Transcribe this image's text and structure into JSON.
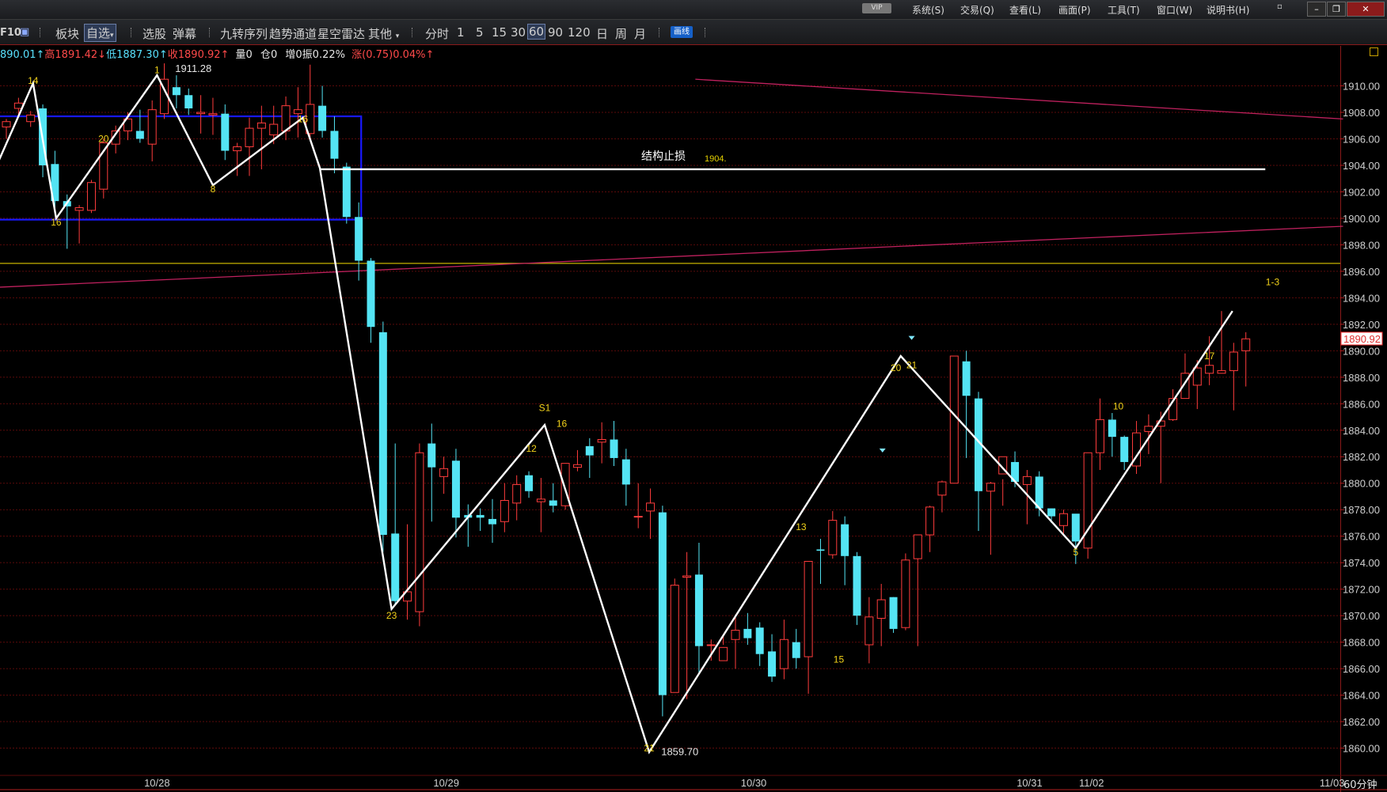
{
  "window": {
    "vip_badge": "VIP",
    "menus": [
      "系统(S)",
      "交易(Q)",
      "查看(L)",
      "画面(P)",
      "工具(T)",
      "窗口(W)",
      "说明书(H)"
    ],
    "buttons": [
      "▫",
      "–",
      "❐",
      "✕"
    ]
  },
  "toolbar": {
    "logo": "F10",
    "items": [
      "板块",
      "自选",
      "选股",
      "弹幕",
      "九转序列",
      "趋势通道",
      "星空雷达",
      "其他"
    ],
    "selected": "自选",
    "periods": [
      "分时",
      "1",
      "5",
      "15",
      "30",
      "60",
      "90",
      "120",
      "日",
      "周",
      "月"
    ],
    "selected_period": "60",
    "draw_button": "画线"
  },
  "infobar": {
    "open": "890.01↑",
    "high_label": "高",
    "high": "1891.42↓",
    "low_label": "低",
    "low": "1887.30↑",
    "close_label": "收",
    "close": "1890.92↑",
    "volume": "量0",
    "position": "仓0",
    "increase": "增0",
    "amplitude": "振0.22%",
    "change_label": "涨",
    "change": "(0.75)0.04%↑"
  },
  "period_label": "60分钟",
  "chart_data": {
    "type": "candlestick",
    "ylim": [
      1858.8,
      1912.6
    ],
    "y_ticks": [
      "1910.00",
      "1908.00",
      "1906.00",
      "1904.00",
      "1902.00",
      "1900.00",
      "1898.00",
      "1896.00",
      "1894.00",
      "1892.00",
      "1890.00",
      "1888.00",
      "1886.00",
      "1884.00",
      "1882.00",
      "1880.00",
      "1878.00",
      "1876.00",
      "1874.00",
      "1872.00",
      "1870.00",
      "1868.00",
      "1866.00",
      "1864.00",
      "1862.00",
      "1860.00"
    ],
    "current_price": "1890.92",
    "x_labels": [
      {
        "label": "10/28",
        "bar": 12.4
      },
      {
        "label": "10/29",
        "bar": 36.2
      },
      {
        "label": "10/30",
        "bar": 61.5
      },
      {
        "label": "10/31",
        "bar": 84.2
      },
      {
        "label": "11/02",
        "bar": 89.3
      },
      {
        "label": "11/03",
        "bar": 109.1
      }
    ],
    "candles": [
      [
        1906.9,
        1907.5,
        1906.0,
        1907.3
      ],
      [
        1908.3,
        1909.1,
        1907.8,
        1908.7
      ],
      [
        1907.3,
        1908.1,
        1906.9,
        1907.8
      ],
      [
        1908.3,
        1908.6,
        1903.1,
        1904.0
      ],
      [
        1904.1,
        1905.1,
        1900.5,
        1901.3
      ],
      [
        1901.3,
        1901.8,
        1897.7,
        1900.9
      ],
      [
        1900.6,
        1901.0,
        1898.1,
        1900.8
      ],
      [
        1900.6,
        1902.9,
        1900.4,
        1902.7
      ],
      [
        1902.2,
        1906.0,
        1901.5,
        1905.7
      ],
      [
        1905.6,
        1907.0,
        1904.9,
        1906.6
      ],
      [
        1906.6,
        1908.0,
        1905.9,
        1907.5
      ],
      [
        1906.6,
        1908.2,
        1905.7,
        1906.0
      ],
      [
        1905.6,
        1908.9,
        1904.3,
        1908.2
      ],
      [
        1907.9,
        1911.7,
        1907.5,
        1910.5
      ],
      [
        1909.9,
        1910.8,
        1908.3,
        1909.3
      ],
      [
        1909.3,
        1909.8,
        1907.8,
        1908.3
      ],
      [
        1907.9,
        1909.3,
        1906.4,
        1908.0
      ],
      [
        1907.8,
        1909.1,
        1906.3,
        1907.9
      ],
      [
        1907.9,
        1908.6,
        1904.4,
        1905.1
      ],
      [
        1905.1,
        1905.7,
        1903.2,
        1905.4
      ],
      [
        1905.4,
        1907.6,
        1903.2,
        1906.8
      ],
      [
        1906.8,
        1908.5,
        1903.7,
        1907.2
      ],
      [
        1906.3,
        1908.5,
        1905.6,
        1907.1
      ],
      [
        1906.6,
        1909.2,
        1905.9,
        1908.5
      ],
      [
        1907.9,
        1909.9,
        1906.1,
        1908.2
      ],
      [
        1906.4,
        1911.6,
        1905.9,
        1908.6
      ],
      [
        1908.5,
        1910.0,
        1906.1,
        1906.6
      ],
      [
        1906.6,
        1907.7,
        1903.4,
        1904.5
      ],
      [
        1903.9,
        1904.2,
        1899.6,
        1900.1
      ],
      [
        1900.1,
        1901.2,
        1895.3,
        1896.8
      ],
      [
        1896.8,
        1897.0,
        1890.6,
        1891.8
      ],
      [
        1891.4,
        1892.2,
        1874.8,
        1876.1
      ],
      [
        1876.2,
        1883.0,
        1870.9,
        1871.1
      ],
      [
        1871.1,
        1876.9,
        1869.7,
        1871.8
      ],
      [
        1870.3,
        1883.0,
        1869.2,
        1882.3
      ],
      [
        1883.0,
        1884.5,
        1877.1,
        1881.2
      ],
      [
        1880.5,
        1882.0,
        1879.2,
        1881.1
      ],
      [
        1881.7,
        1882.6,
        1875.9,
        1877.4
      ],
      [
        1877.6,
        1878.4,
        1875.2,
        1877.4
      ],
      [
        1877.6,
        1878.1,
        1876.4,
        1877.4
      ],
      [
        1877.3,
        1878.8,
        1875.5,
        1876.9
      ],
      [
        1877.1,
        1880.0,
        1876.3,
        1878.7
      ],
      [
        1878.5,
        1880.6,
        1877.2,
        1879.9
      ],
      [
        1880.6,
        1880.9,
        1878.9,
        1879.4
      ],
      [
        1878.6,
        1880.4,
        1876.3,
        1878.8
      ],
      [
        1878.7,
        1880.0,
        1877.8,
        1878.3
      ],
      [
        1878.3,
        1881.2,
        1878.0,
        1881.5
      ],
      [
        1881.2,
        1882.5,
        1880.9,
        1881.4
      ],
      [
        1882.8,
        1883.4,
        1880.4,
        1882.1
      ],
      [
        1883.1,
        1884.6,
        1881.5,
        1883.3
      ],
      [
        1883.3,
        1884.7,
        1881.3,
        1881.9
      ],
      [
        1881.8,
        1882.6,
        1878.3,
        1879.9
      ],
      [
        1877.5,
        1880.0,
        1876.6,
        1877.5
      ],
      [
        1877.9,
        1879.6,
        1875.8,
        1878.5
      ],
      [
        1877.8,
        1878.3,
        1862.4,
        1864.0
      ],
      [
        1864.2,
        1872.8,
        1864.4,
        1872.3
      ],
      [
        1872.9,
        1874.8,
        1863.7,
        1873.0
      ],
      [
        1873.1,
        1875.5,
        1865.7,
        1867.7
      ],
      [
        1867.8,
        1868.2,
        1866.6,
        1867.8
      ],
      [
        1866.6,
        1868.6,
        1867.8,
        1867.6
      ],
      [
        1868.2,
        1870.1,
        1866.0,
        1868.9
      ],
      [
        1869.0,
        1870.2,
        1867.8,
        1868.3
      ],
      [
        1869.1,
        1869.5,
        1866.2,
        1867.1
      ],
      [
        1867.3,
        1868.6,
        1865.0,
        1865.4
      ],
      [
        1866.0,
        1869.7,
        1865.2,
        1868.2
      ],
      [
        1868.0,
        1869.0,
        1866.0,
        1866.8
      ],
      [
        1866.9,
        1874.1,
        1864.1,
        1874.1
      ],
      [
        1875.0,
        1875.8,
        1872.4,
        1874.9
      ],
      [
        1874.6,
        1877.9,
        1874.3,
        1877.2
      ],
      [
        1876.9,
        1877.5,
        1872.3,
        1874.5
      ],
      [
        1874.5,
        1874.8,
        1869.3,
        1870.0
      ],
      [
        1867.8,
        1871.4,
        1866.4,
        1869.9
      ],
      [
        1869.8,
        1872.4,
        1867.7,
        1871.2
      ],
      [
        1871.4,
        1871.4,
        1868.7,
        1869.0
      ],
      [
        1869.1,
        1874.7,
        1868.9,
        1874.2
      ],
      [
        1874.3,
        1875.7,
        1867.7,
        1876.1
      ],
      [
        1876.1,
        1878.3,
        1874.8,
        1878.2
      ],
      [
        1879.1,
        1880.2,
        1877.8,
        1880.1
      ],
      [
        1880.0,
        1889.0,
        1880.0,
        1889.6
      ],
      [
        1889.2,
        1890.0,
        1881.9,
        1886.6
      ],
      [
        1886.4,
        1886.9,
        1876.4,
        1879.4
      ],
      [
        1879.4,
        1880.1,
        1874.6,
        1880.0
      ],
      [
        1880.7,
        1880.3,
        1878.3,
        1882.0
      ],
      [
        1881.6,
        1882.4,
        1879.7,
        1880.1
      ],
      [
        1879.9,
        1881.0,
        1876.9,
        1880.5
      ],
      [
        1880.5,
        1880.9,
        1877.5,
        1878.1
      ],
      [
        1878.1,
        1878.1,
        1877.0,
        1877.5
      ],
      [
        1876.8,
        1878.0,
        1876.2,
        1877.7
      ],
      [
        1877.7,
        1877.2,
        1873.9,
        1875.6
      ],
      [
        1875.1,
        1880.0,
        1874.3,
        1882.3
      ],
      [
        1882.3,
        1886.4,
        1881.0,
        1884.8
      ],
      [
        1884.8,
        1885.3,
        1882.0,
        1883.5
      ],
      [
        1883.5,
        1883.6,
        1881.0,
        1881.6
      ],
      [
        1881.3,
        1884.7,
        1880.7,
        1883.8
      ],
      [
        1883.9,
        1885.2,
        1882.2,
        1884.3
      ],
      [
        1884.3,
        1885.4,
        1880.0,
        1884.7
      ],
      [
        1884.8,
        1887.1,
        1884.7,
        1886.4
      ],
      [
        1886.4,
        1889.8,
        1886.8,
        1888.3
      ],
      [
        1887.4,
        1889.3,
        1885.6,
        1888.7
      ],
      [
        1888.3,
        1891.1,
        1887.4,
        1888.9
      ],
      [
        1888.3,
        1893.0,
        1888.3,
        1888.5
      ],
      [
        1888.5,
        1890.6,
        1885.5,
        1889.9
      ],
      [
        1890.0,
        1891.4,
        1887.3,
        1890.9
      ]
    ],
    "zigzag": [
      [
        -0.6,
        1904.4
      ],
      [
        2.2,
        1910.2
      ],
      [
        4.1,
        1900.0
      ],
      [
        12.4,
        1910.8
      ],
      [
        17.0,
        1902.5
      ],
      [
        24.4,
        1907.6
      ],
      [
        25.8,
        1903.8
      ],
      [
        31.7,
        1870.5
      ],
      [
        44.3,
        1884.4
      ],
      [
        52.9,
        1859.7
      ],
      [
        73.6,
        1889.6
      ],
      [
        88.0,
        1875.1
      ],
      [
        100.9,
        1893.0
      ]
    ],
    "numbers": [
      {
        "text": "14",
        "bar": 2.2,
        "y": 1910.4
      },
      {
        "text": "16",
        "bar": 4.1,
        "y": 1899.7
      },
      {
        "text": "20",
        "bar": 8.0,
        "y": 1906.0
      },
      {
        "text": "1",
        "bar": 12.4,
        "y": 1911.2
      },
      {
        "text": "8",
        "bar": 17.0,
        "y": 1902.2
      },
      {
        "text": "16",
        "bar": 24.4,
        "y": 1907.5
      },
      {
        "text": "23",
        "bar": 31.7,
        "y": 1870.0
      },
      {
        "text": "12",
        "bar": 43.2,
        "y": 1882.6
      },
      {
        "text": "S1",
        "bar": 44.3,
        "y": 1885.7
      },
      {
        "text": "16",
        "bar": 45.7,
        "y": 1884.5
      },
      {
        "text": "21",
        "bar": 52.9,
        "y": 1860.0
      },
      {
        "text": "13",
        "bar": 65.4,
        "y": 1876.7
      },
      {
        "text": "15",
        "bar": 68.5,
        "y": 1866.7
      },
      {
        "text": "20",
        "bar": 73.2,
        "y": 1888.7
      },
      {
        "text": "21",
        "bar": 74.5,
        "y": 1888.9
      },
      {
        "text": "5",
        "bar": 88.0,
        "y": 1874.8
      },
      {
        "text": "10",
        "bar": 91.5,
        "y": 1885.8
      },
      {
        "text": "17",
        "bar": 99.0,
        "y": 1889.6
      },
      {
        "text": "1-3",
        "bar": 104.2,
        "y": 1895.2
      }
    ],
    "annotations": [
      {
        "text": "1911.28",
        "bar": 13.5,
        "y": 1911.3
      },
      {
        "text": "1859.70",
        "bar": 53.5,
        "y": 1859.7
      }
    ],
    "stop_line": {
      "label": "结构止损",
      "value_label": "1904.",
      "y": 1903.7,
      "from_bar": 25.8,
      "to_bar": 103.6
    },
    "box": {
      "from_bar": -0.6,
      "to_bar": 29.2,
      "top": 1907.7,
      "bottom": 1899.9
    },
    "trend_lines": [
      {
        "from": [
          56.7,
          1910.5
        ],
        "to": [
          110.0,
          1907.5
        ],
        "color": "#c0215e"
      },
      {
        "from": [
          -0.6,
          1894.8
        ],
        "to": [
          110.0,
          1899.4
        ],
        "color": "#c0215e"
      }
    ],
    "horizontal_line": {
      "y": 1896.6,
      "color": "#c6b200"
    },
    "markers": [
      {
        "bar": 74.5,
        "y": 1891.0
      },
      {
        "bar": 72.1,
        "y": 1882.5
      }
    ]
  }
}
